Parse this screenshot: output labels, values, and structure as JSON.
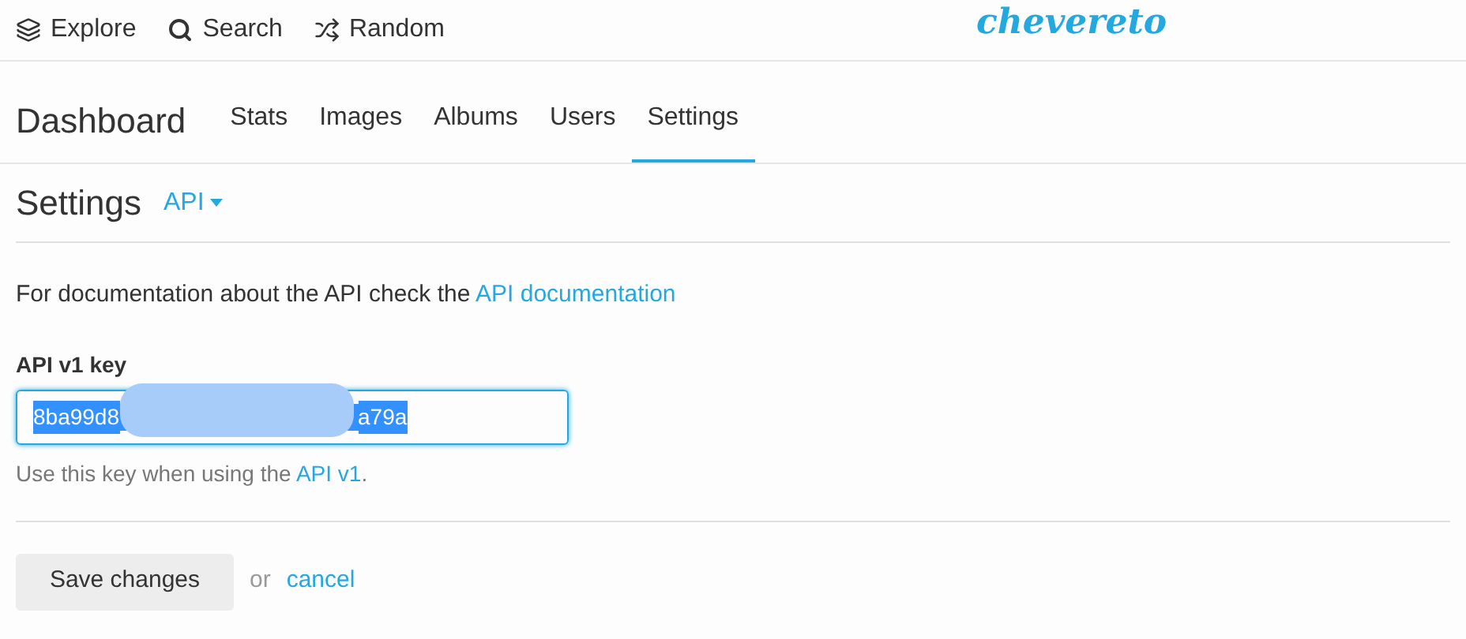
{
  "top_nav": [
    {
      "kind": "layers",
      "label": "Explore"
    },
    {
      "kind": "search",
      "label": "Search"
    },
    {
      "kind": "shuffle",
      "label": "Random"
    }
  ],
  "logo": "chevereto",
  "dashboard": {
    "title": "Dashboard",
    "tabs": [
      {
        "label": "Stats",
        "selected": false
      },
      {
        "label": "Images",
        "selected": false
      },
      {
        "label": "Albums",
        "selected": false
      },
      {
        "label": "Users",
        "selected": false
      },
      {
        "label": "Settings",
        "selected": true
      }
    ]
  },
  "settings": {
    "title": "Settings",
    "section_dropdown": "API"
  },
  "intro": {
    "text": "For documentation about the API check the",
    "link": "API documentation"
  },
  "api_key": {
    "label": "API v1 key",
    "value_start": "8ba99d8",
    "value_end": "a79a",
    "help_text": "Use this key when using the",
    "help_link": "API v1",
    "help_end": "."
  },
  "actions": {
    "save": "Save changes",
    "or": "or",
    "cancel": "cancel"
  }
}
